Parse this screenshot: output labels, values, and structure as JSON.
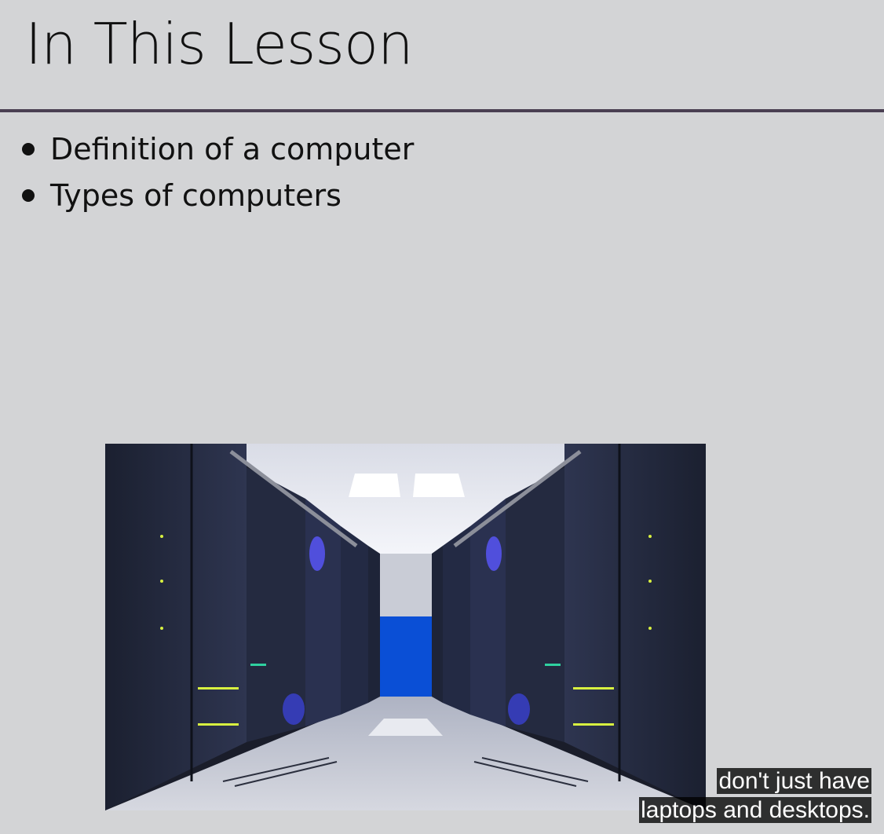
{
  "slide": {
    "title": "In This Lesson",
    "bullets": [
      "Definition of a computer",
      "Types of computers"
    ]
  },
  "image": {
    "subject": "server-room-icon"
  },
  "subtitles": {
    "line1": "don't just have",
    "line2": "laptops and desktops."
  },
  "colors": {
    "background": "#d3d4d6",
    "divider": "#4a3f52",
    "corridor_end": "#0a4fd6"
  }
}
